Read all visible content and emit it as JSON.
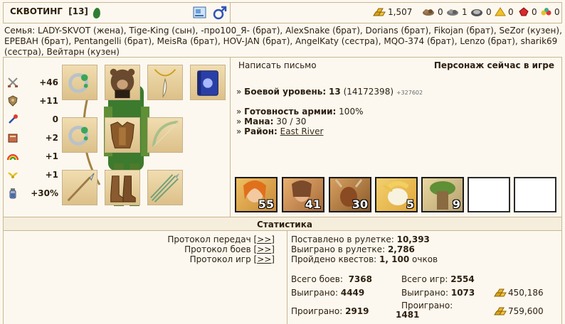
{
  "header": {
    "name": "СКВОТИНГ",
    "level": "[13]",
    "resources": {
      "gold": "1,507",
      "r1": "0",
      "r2": "1",
      "r3": "0",
      "r4": "0",
      "r5": "0",
      "r6": "0"
    }
  },
  "family": "Семья: LADY-SKVOT (жена), Tige-King (сын), -про100_Я- (брат), AlexSnake (брат), Dorians (брат), Fikojan (брат), SeZor (кузен), ЕРЕВАН (брат), Pentangelli (брат), MeisRa (брат), HOV-JAN (брат), AngelKaty (сестра), MQO-374 (брат), Lenzo (брат), sharik69 (сестра), Вейтарн (кузен)",
  "stats": [
    {
      "icon": "swords-icon",
      "value": "+46"
    },
    {
      "icon": "shield-icon",
      "value": "+11"
    },
    {
      "icon": "wand-icon",
      "value": "0"
    },
    {
      "icon": "spellbook-icon",
      "value": "+2"
    },
    {
      "icon": "rainbow-icon",
      "value": "+1"
    },
    {
      "icon": "wings-icon",
      "value": "+1"
    },
    {
      "icon": "potion-icon",
      "value": "+30%"
    }
  ],
  "profile": {
    "write_letter": "Написать письмо",
    "status": "Персонаж сейчас в игре",
    "combat_level_label": "Боевой уровень:",
    "combat_level": "13",
    "experience": "(14172398)",
    "experience_delta": "+327602",
    "army_ready_label": "Готовность армии:",
    "army_ready": "100%",
    "mana_label": "Мана:",
    "mana": "30 / 30",
    "district_label": "Район:",
    "district": "East River",
    "bullet": "»"
  },
  "army": [
    "55",
    "41",
    "30",
    "5",
    "9",
    "",
    ""
  ],
  "statistics": {
    "title": "Статистика",
    "protocols": [
      {
        "label": "Протокол передач",
        "link": "[>>]"
      },
      {
        "label": "Протокол боев",
        "link": "[>>]"
      },
      {
        "label": "Протокол игр",
        "link": "[>>]"
      }
    ],
    "roulette_bet_label": "Поставлено в рулетке:",
    "roulette_bet": "10,393",
    "roulette_won_label": "Выиграно в рулетке:",
    "roulette_won": "2,786",
    "quests_label": "Пройдено квестов:",
    "quests": "1, 100",
    "quests_suffix": "очков",
    "battles_total_label": "Всего боев:",
    "battles_total": "7368",
    "battles_won_label": "Выиграно:",
    "battles_won": "4449",
    "battles_lost_label": "Проиграно:",
    "battles_lost": "2919",
    "games_total_label": "Всего игр:",
    "games_total": "2554",
    "games_won_label": "Выиграно:",
    "games_won": "1073",
    "games_lost_label": "Проиграно:",
    "games_lost": "1481",
    "gold_won": "450,186",
    "gold_lost": "759,600"
  }
}
